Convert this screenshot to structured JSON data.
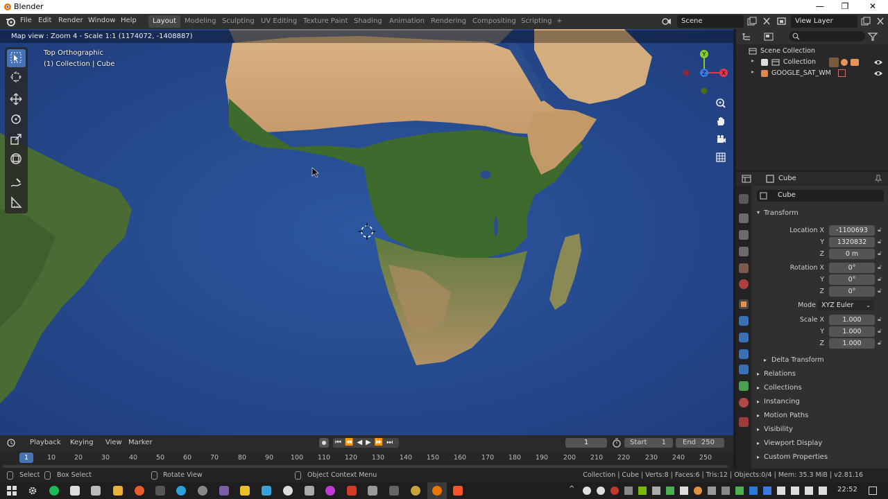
{
  "window": {
    "title": "Blender"
  },
  "menu": [
    "File",
    "Edit",
    "Render",
    "Window",
    "Help"
  ],
  "workspaces": [
    {
      "label": "Layout",
      "active": true
    },
    {
      "label": "Modeling"
    },
    {
      "label": "Sculpting"
    },
    {
      "label": "UV Editing"
    },
    {
      "label": "Texture Paint"
    },
    {
      "label": "Shading"
    },
    {
      "label": "Animation"
    },
    {
      "label": "Rendering"
    },
    {
      "label": "Compositing"
    },
    {
      "label": "Scripting"
    },
    {
      "label": "+"
    }
  ],
  "scene": {
    "name": "Scene",
    "view_layer": "View Layer"
  },
  "viewport": {
    "status": "Map view : Zoom 4 - Scale 1:1 (1174072, -1408887)",
    "view_name": "Top Orthographic",
    "collection_info": "(1) Collection | Cube",
    "gizmo": {
      "y": "Y",
      "z": "Z",
      "x": "X"
    }
  },
  "outliner": {
    "root": "Scene Collection",
    "items": [
      {
        "label": "Collection"
      },
      {
        "label": "GOOGLE_SAT_WM"
      }
    ]
  },
  "properties": {
    "object_name": "Cube",
    "datablock_name": "Cube",
    "transform_header": "Transform",
    "location": {
      "label": "Location X",
      "y_label": "Y",
      "z_label": "Z",
      "x": "-1100693",
      "y": "1320832",
      "z": "0 m"
    },
    "rotation": {
      "label": "Rotation X",
      "y_label": "Y",
      "z_label": "Z",
      "x": "0°",
      "y": "0°",
      "z": "0°"
    },
    "mode": {
      "label": "Mode",
      "value": "XYZ Euler"
    },
    "scale": {
      "label": "Scale X",
      "y_label": "Y",
      "z_label": "Z",
      "x": "1.000",
      "y": "1.000",
      "z": "1.000"
    },
    "delta_transform": "Delta Transform",
    "panels": [
      "Relations",
      "Collections",
      "Instancing",
      "Motion Paths",
      "Visibility",
      "Viewport Display",
      "Custom Properties"
    ]
  },
  "timeline": {
    "menus": [
      "Playback",
      "Keying",
      "View",
      "Marker"
    ],
    "current_frame": "1",
    "start_label": "Start",
    "start": "1",
    "end_label": "End",
    "end": "250",
    "ruler": [
      "1",
      "10",
      "20",
      "30",
      "40",
      "50",
      "60",
      "70",
      "80",
      "90",
      "100",
      "110",
      "120",
      "130",
      "140",
      "150",
      "160",
      "170",
      "180",
      "190",
      "200",
      "210",
      "220",
      "230",
      "240",
      "250"
    ]
  },
  "statusbar": {
    "select": "Select",
    "box_select": "Box Select",
    "rotate_view": "Rotate View",
    "context_menu": "Object Context Menu",
    "info": "Collection | Cube | Verts:8 | Faces:6 | Tris:12 | Objects:0/4 | Mem: 35.3 MiB | v2.81.16"
  },
  "taskbar": {
    "time": "22:52"
  }
}
